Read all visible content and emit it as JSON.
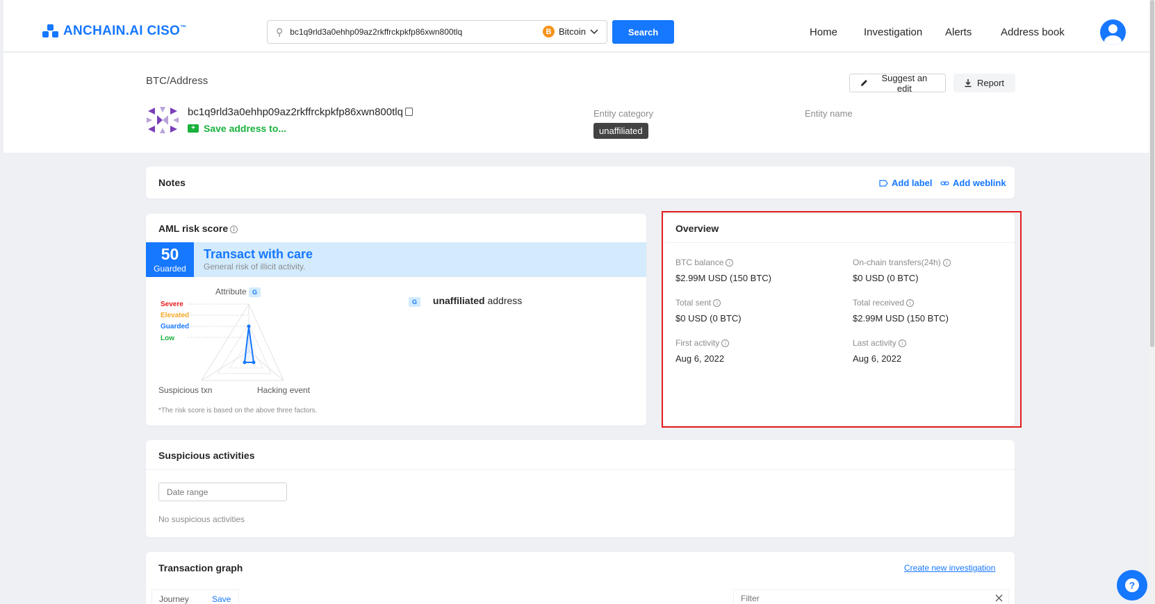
{
  "header": {
    "logo_text": "ANCHAIN.AI",
    "logo_product": "CISO",
    "logo_tm": "™",
    "search_value": "bc1q9rld3a0ehhp09az2rkffrckpkfp86xwn800tlq",
    "chain_label": "Bitcoin",
    "search_button": "Search",
    "nav": [
      "Home",
      "Investigation",
      "Alerts",
      "Address book"
    ]
  },
  "address": {
    "breadcrumb": "BTC/Address",
    "value": "bc1q9rld3a0ehhp09az2rkffrckpkfp86xwn800tlq",
    "save_label": "Save address to...",
    "suggest_edit": "Suggest an edit",
    "report": "Report",
    "entity_category_label": "Entity category",
    "entity_category_value": "unaffiliated",
    "entity_name_label": "Entity name"
  },
  "notes": {
    "title": "Notes",
    "add_label": "Add label",
    "add_weblink": "Add weblink"
  },
  "aml": {
    "title": "AML risk score",
    "score": "50",
    "score_level": "Guarded",
    "risk_title": "Transact with care",
    "risk_subtitle": "General risk of illicit activity.",
    "levels": [
      "Severe",
      "Elevated",
      "Guarded",
      "Low"
    ],
    "level_colors": [
      "#e51c1c",
      "#f5a623",
      "#1677ff",
      "#18b13c"
    ],
    "radar_axes": [
      "Attribute",
      "Suspicious txn",
      "Hacking event"
    ],
    "attribute_badge": "G",
    "factor_badge": "G",
    "factor_bold": "unaffiliated",
    "factor_rest": "address",
    "footnote": "*The risk score is based on the above three factors."
  },
  "overview": {
    "title": "Overview",
    "btc_balance_label": "BTC balance",
    "btc_balance_value": "$2.99M USD (150 BTC)",
    "onchain_label": "On-chain transfers(24h)",
    "onchain_value": "$0 USD (0 BTC)",
    "total_sent_label": "Total sent",
    "total_sent_value": "$0 USD (0 BTC)",
    "total_received_label": "Total received",
    "total_received_value": "$2.99M USD (150 BTC)",
    "first_activity_label": "First activity",
    "first_activity_value": "Aug 6, 2022",
    "last_activity_label": "Last activity",
    "last_activity_value": "Aug 6, 2022"
  },
  "suspicious": {
    "title": "Suspicious activities",
    "date_placeholder": "Date range",
    "empty": "No suspicious activities"
  },
  "graph": {
    "title": "Transaction graph",
    "create_link": "Create new investigation",
    "journey_label": "Journey",
    "save_label": "Save",
    "filter_placeholder": "Filter"
  },
  "help_glyph": "?",
  "colors": {
    "primary": "#1677ff",
    "success": "#18b13c",
    "highlight": "#e51c1c"
  }
}
